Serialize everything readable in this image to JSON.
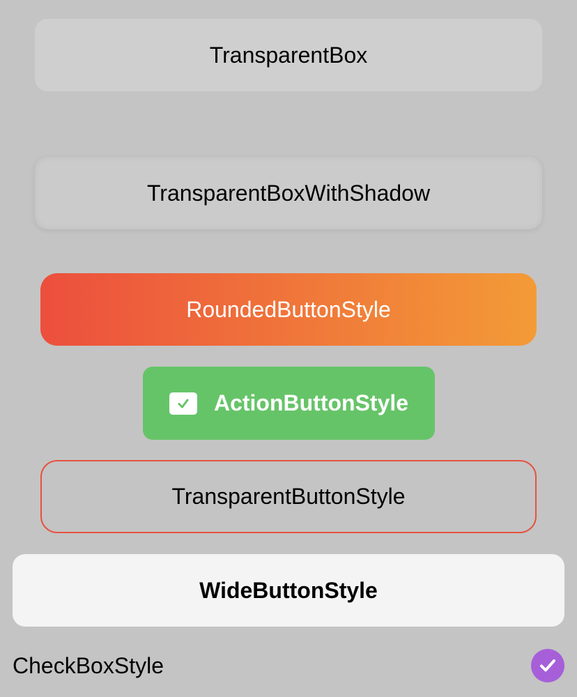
{
  "colors": {
    "background": "#c4c4c4",
    "gradient_start": "#ec4f3d",
    "gradient_end": "#f39b37",
    "action_green": "#66c468",
    "transparent_border": "#e5533f",
    "checkbox_purple": "#a65fd8",
    "checkbox_check_color": "#66c468"
  },
  "buttons": {
    "transparent_box": "TransparentBox",
    "transparent_box_with_shadow": "TransparentBoxWithShadow",
    "rounded_button_style": "RoundedButtonStyle",
    "action_button_style": {
      "label": "ActionButtonStyle",
      "icon": "checkbox-checked-icon"
    },
    "transparent_button_style": "TransparentButtonStyle",
    "wide_button_style": "WideButtonStyle"
  },
  "checkbox_style": {
    "label": "CheckBoxStyle",
    "checked": true,
    "icon": "checkmark-icon"
  }
}
